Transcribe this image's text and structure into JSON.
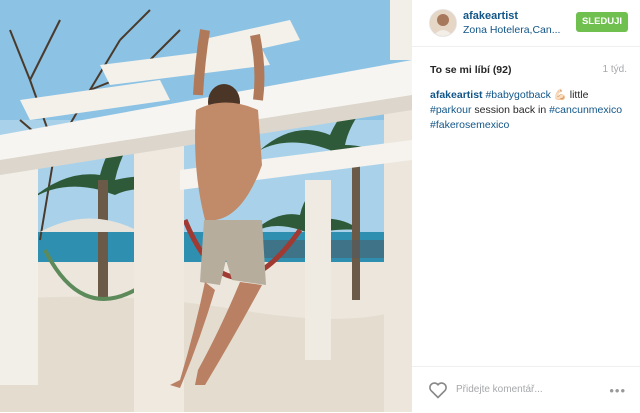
{
  "post": {
    "username": "afakeartist",
    "location": "Zona Hotelera,Can...",
    "follow_label": "SLEDUJI",
    "likes_label": "To se mi líbí (92)",
    "time_label": "1 týd.",
    "caption": {
      "user": "afakeartist",
      "hashtag_1": "#babygotback",
      "emoji": "💪🏻",
      "word_1": "little",
      "hashtag_2": "#parkour",
      "middle_text": "session back in",
      "hashtag_3": "#cancunmexico",
      "hashtag_4": "#fakerosemexico"
    },
    "comment_placeholder": "Přidejte komentář...",
    "more_label": "•••"
  },
  "icons": {
    "like": "heart-icon",
    "options": "more-options-icon"
  },
  "colors": {
    "link": "#125688",
    "follow_button": "#70c050",
    "muted": "#a5a7aa"
  }
}
